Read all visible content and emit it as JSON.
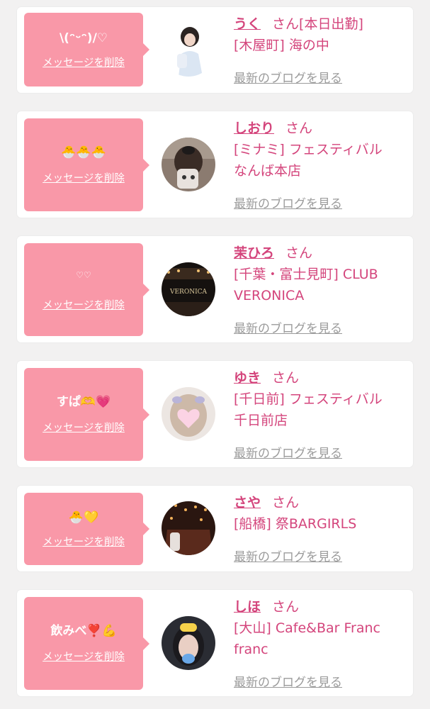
{
  "items": [
    {
      "message": "\\(ᵔᵕᵔ)/♡",
      "delete_label": "メッセージを削除",
      "name": "うく",
      "honorific": "さん",
      "status": "[本日出勤]",
      "shop_lines": [
        "[木屋町] 海の中"
      ],
      "blog_label": "最新のブログを見る"
    },
    {
      "message": "🐣🐣🐣",
      "delete_label": "メッセージを削除",
      "name": "しおり",
      "honorific": "さん",
      "status": "",
      "shop_lines": [
        "[ミナミ] フェスティバル",
        "なんば本店"
      ],
      "blog_label": "最新のブログを見る"
    },
    {
      "message": "♡♡",
      "delete_label": "メッセージを削除",
      "name": "茉ひろ",
      "honorific": "さん",
      "status": "",
      "shop_lines": [
        "[千葉・富士見町] CLUB",
        "VERONICA"
      ],
      "blog_label": "最新のブログを見る",
      "avatar_text": "VERONICA"
    },
    {
      "message": "すぱ🫶💗",
      "delete_label": "メッセージを削除",
      "name": "ゆき",
      "honorific": "さん",
      "status": "",
      "shop_lines": [
        "[千日前] フェスティバル",
        "千日前店"
      ],
      "blog_label": "最新のブログを見る"
    },
    {
      "message": "🐣💛",
      "delete_label": "メッセージを削除",
      "name": "さや",
      "honorific": "さん",
      "status": "",
      "shop_lines": [
        "[船橋] 祭BARGIRLS"
      ],
      "blog_label": "最新のブログを見る"
    },
    {
      "message": "飲みべ❣️💪",
      "delete_label": "メッセージを削除",
      "name": "しほ",
      "honorific": "さん",
      "status": "",
      "shop_lines": [
        "[大山] Cafe&Bar Franc",
        "franc"
      ],
      "blog_label": "最新のブログを見る"
    }
  ],
  "colors": {
    "page_background": "#f2f1f1",
    "bubble": "#f998a8",
    "name_text": "#d4457c",
    "blog_link": "#9b9b9b"
  }
}
